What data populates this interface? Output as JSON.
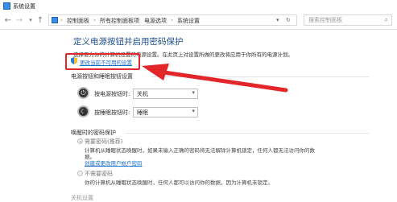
{
  "window": {
    "title": "系统设置"
  },
  "nav": {
    "back": "←",
    "forward": "→",
    "up": "↑",
    "breadcrumb": [
      "控制面板",
      "所有控制面板项",
      "电源选项",
      "系统设置"
    ],
    "separator": "›",
    "dropdown_glyph": "▾",
    "refresh_glyph": "↻"
  },
  "search": {
    "placeholder": "搜索控制面板",
    "icon": "search-icon"
  },
  "page": {
    "heading": "定义电源按钮并启用密码保护",
    "intro": "选择要为你的计算机设置的电源设置。在此页上对设置所做的更改将应用于你所有的电源计划。",
    "change_link": "更改当前不可用的设置"
  },
  "power_section": {
    "title": "电源按钮和睡眠按钮设置",
    "rows": [
      {
        "label": "按电源按钮时:",
        "value": "关机"
      },
      {
        "label": "按睡眠按钮时:",
        "value": "睡眠"
      }
    ]
  },
  "wake_section": {
    "title": "唤醒时的密码保护",
    "options": [
      {
        "label": "需要密码(推荐)",
        "selected": true,
        "desc1": "计算机从睡眠状态唤醒时，如果未输入正确的密码将无法解除计算机锁定，任何人都无法访问你的数",
        "desc2": "据。",
        "link": "创建或更改用户帐户密码"
      },
      {
        "label": "不需要密码",
        "selected": false,
        "desc1": "你的计算机从睡眠状态唤醒时，任何人都可以访问你的数据，因为计算机未锁定。"
      }
    ]
  },
  "footer_faded": "关机设置",
  "colors": {
    "accent": "#1e4e8c",
    "link": "#1a6fc9",
    "highlight": "#e3262a"
  }
}
